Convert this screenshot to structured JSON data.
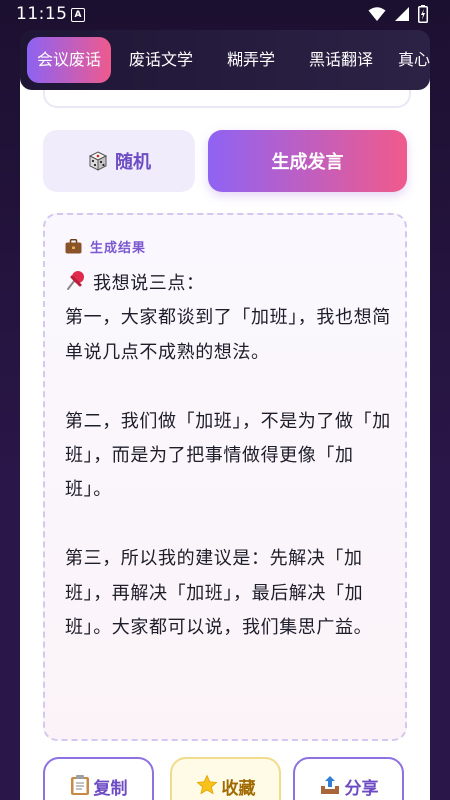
{
  "status_bar": {
    "time": "11:15",
    "notification_letter": "A"
  },
  "tabs": [
    {
      "label": "会议废话",
      "active": true
    },
    {
      "label": "废话文学",
      "active": false
    },
    {
      "label": "糊弄学",
      "active": false
    },
    {
      "label": "黑话翻译",
      "active": false
    },
    {
      "label": "真心",
      "active": false
    }
  ],
  "controls": {
    "random_label": "随机",
    "random_icon": "dice-icon",
    "generate_label": "生成发言"
  },
  "result": {
    "header_icon": "briefcase-icon",
    "header_label": "生成结果",
    "body_icon": "pushpin-icon",
    "first_line": "我想说三点：",
    "body_rest": "\n第一，大家都谈到了「加班」，我也想简单说几点不成熟的想法。\n\n第二，我们做「加班」，不是为了做「加班」，而是为了把事情做得更像「加班」。\n\n第三，所以我的建议是：先解决「加班」，再解决「加班」，最后解决「加班」。大家都可以说，我们集思广益。"
  },
  "actions": [
    {
      "label": "复制",
      "icon": "clipboard-icon"
    },
    {
      "label": "收藏",
      "icon": "star-icon"
    },
    {
      "label": "分享",
      "icon": "share-tray-icon"
    }
  ],
  "colors": {
    "accent_purple": "#8f63f3",
    "accent_pink": "#f05a8c",
    "tab_bar_bg": "#1f1636",
    "result_text": "#1e1e2a"
  }
}
